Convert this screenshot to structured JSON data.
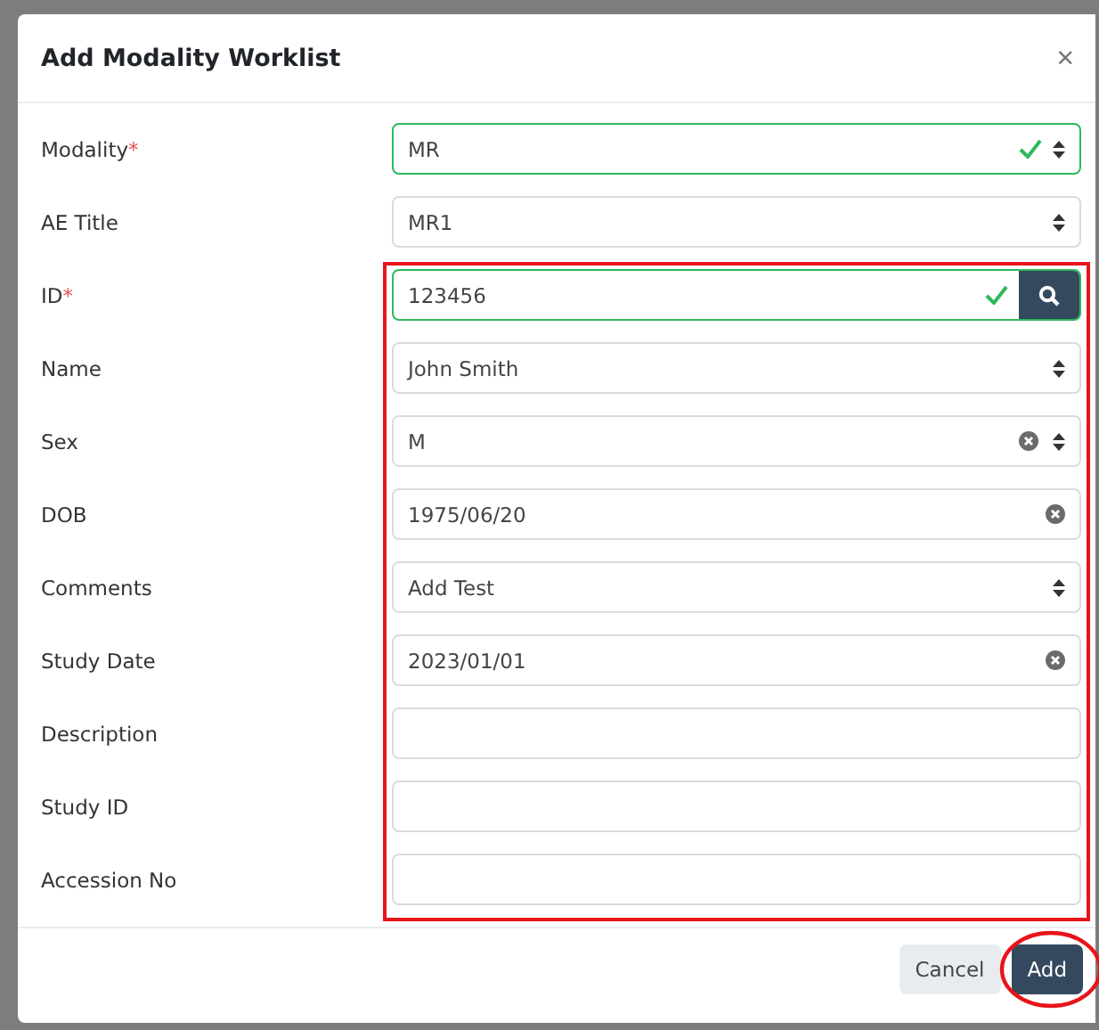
{
  "dialog": {
    "title": "Add Modality Worklist",
    "close": "×"
  },
  "fields": [
    {
      "label": "Modality",
      "mark": "*",
      "kind": "select",
      "value": "MR",
      "valid": true,
      "clearable": false
    },
    {
      "label": "AE Title",
      "kind": "select",
      "value": "MR1",
      "valid": false,
      "clearable": false
    },
    {
      "label": "ID",
      "mark": "*",
      "kind": "search",
      "value": "123456",
      "valid": true,
      "clearable": false
    },
    {
      "label": "Name",
      "kind": "select",
      "value": "John Smith",
      "valid": false,
      "clearable": false
    },
    {
      "label": "Sex",
      "kind": "select",
      "value": "M",
      "valid": false,
      "clearable": true
    },
    {
      "label": "DOB",
      "kind": "text",
      "value": "1975/06/20",
      "valid": false,
      "clearable": true
    },
    {
      "label": "Comments",
      "kind": "select",
      "value": "Add Test",
      "valid": false,
      "clearable": false
    },
    {
      "label": "Study Date",
      "kind": "text",
      "value": "2023/01/01",
      "valid": false,
      "clearable": true
    },
    {
      "label": "Description",
      "kind": "text",
      "valid": false,
      "clearable": false
    },
    {
      "label": "Study ID",
      "kind": "text",
      "valid": false,
      "clearable": false
    },
    {
      "label": "Accession No",
      "kind": "text",
      "valid": false,
      "clearable": false
    }
  ],
  "annotations": {
    "rectangle": true
  },
  "buttons": [
    {
      "label": "Cancel",
      "kind": "secondary",
      "circled": false
    },
    {
      "label": "Add",
      "kind": "primary",
      "circled": true
    }
  ]
}
